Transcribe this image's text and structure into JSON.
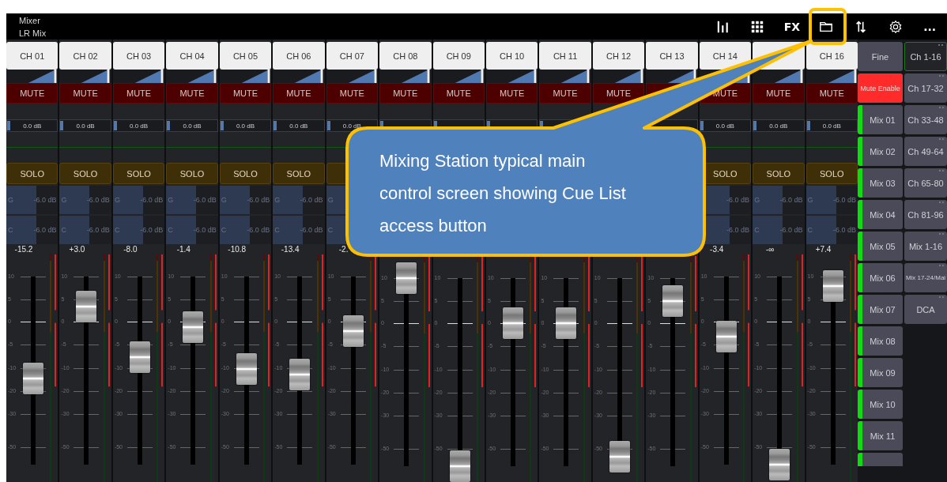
{
  "window": {
    "title": "Mixer",
    "subtitle": "LR Mix"
  },
  "toolbar": [
    {
      "kind": "bars"
    },
    {
      "kind": "grid"
    },
    {
      "kind": "text",
      "label": "FX"
    },
    {
      "kind": "folder",
      "highlighted": true
    },
    {
      "kind": "swap"
    },
    {
      "kind": "gear"
    },
    {
      "kind": "text",
      "label": "..."
    }
  ],
  "channels": [
    {
      "name": "CH 01",
      "mute": "MUTE",
      "gain": "0.0 dB",
      "solo": "SOLO",
      "sends": [
        {
          "label": "G",
          "value": "-6.0 dB"
        },
        {
          "label": "C",
          "value": "-6.0 dB"
        }
      ],
      "value": "-15.2",
      "level": 0.46,
      "scale": [
        "10",
        "5",
        "0",
        "-5",
        "-10",
        "-20",
        "-30",
        "-50"
      ]
    },
    {
      "name": "CH 02",
      "mute": "MUTE",
      "gain": "0.0 dB",
      "solo": "SOLO",
      "sends": [
        {
          "label": "G",
          "value": "-6.0 dB"
        },
        {
          "label": "C",
          "value": "-6.0 dB"
        }
      ],
      "value": "+3.0",
      "level": 0.84,
      "scale": [
        "10",
        "5",
        "0",
        "-5",
        "-10",
        "-20",
        "-30",
        "-50"
      ]
    },
    {
      "name": "CH 03",
      "mute": "MUTE",
      "gain": "0.0 dB",
      "solo": "SOLO",
      "sends": [
        {
          "label": "G",
          "value": "-6.0 dB"
        },
        {
          "label": "C",
          "value": "-6.0 dB"
        }
      ],
      "value": "-8.0",
      "level": 0.57,
      "scale": [
        "10",
        "5",
        "0",
        "-5",
        "-10",
        "-20",
        "-30",
        "-50"
      ]
    },
    {
      "name": "CH 04",
      "mute": "MUTE",
      "gain": "0.0 dB",
      "solo": "SOLO",
      "sends": [
        {
          "label": "G",
          "value": "-6.0 dB"
        },
        {
          "label": "C",
          "value": "-6.0 dB"
        }
      ],
      "value": "-1.4",
      "level": 0.73,
      "scale": [
        "10",
        "5",
        "0",
        "-5",
        "-10",
        "-20",
        "-30",
        "-50"
      ]
    },
    {
      "name": "CH 05",
      "mute": "MUTE",
      "gain": "0.0 dB",
      "solo": "SOLO",
      "sends": [
        {
          "label": "G",
          "value": "-6.0 dB"
        },
        {
          "label": "C",
          "value": "-6.0 dB"
        }
      ],
      "value": "-10.8",
      "level": 0.51,
      "scale": [
        "10",
        "5",
        "0",
        "-5",
        "-10",
        "-20",
        "-30",
        "-50"
      ]
    },
    {
      "name": "CH 06",
      "mute": "MUTE",
      "gain": "0.0 dB",
      "solo": "SOLO",
      "sends": [
        {
          "label": "G",
          "value": "-6.0 dB"
        },
        {
          "label": "C",
          "value": "-6.0 dB"
        }
      ],
      "value": "-13.4",
      "level": 0.48,
      "scale": [
        "10",
        "5",
        "0",
        "-5",
        "-10",
        "-20",
        "-30",
        "-50"
      ]
    },
    {
      "name": "CH 07",
      "mute": "MUTE",
      "gain": "0.0 dB",
      "sends": [
        {
          "label": "G"
        },
        {
          "label": "C"
        }
      ],
      "value": "-2.",
      "level": 0.71,
      "scale": [
        "10",
        "5",
        "0",
        "-5",
        "-10",
        "-20",
        "-30",
        "-50"
      ]
    },
    {
      "name": "CH 08",
      "mute": "MUTE",
      "gain_field": true,
      "level": 1.0,
      "scale": [
        "10",
        "5",
        "0",
        "-5",
        "-10",
        "-20",
        "-30",
        "-50"
      ]
    },
    {
      "name": "CH 09",
      "mute": "MUTE",
      "gain_field": true,
      "level": 0.0,
      "scale": [
        "10",
        "5",
        "0",
        "-5",
        "-10",
        "-20",
        "-30",
        "-50"
      ]
    },
    {
      "name": "CH 10",
      "mute": "MUTE",
      "gain_field": true,
      "level": 0.76,
      "scale": [
        "10",
        "5",
        "0",
        "-5",
        "-10",
        "-20",
        "-30",
        "-50"
      ]
    },
    {
      "name": "CH 11",
      "mute": "MUTE",
      "gain_field": true,
      "level": 0.76,
      "scale": [
        "10",
        "5",
        "0",
        "-5",
        "-10",
        "-20",
        "-30",
        "-50"
      ]
    },
    {
      "name": "CH 12",
      "mute": "MUTE",
      "level": 0.05,
      "scale": [
        "10",
        "5",
        "0",
        "-5",
        "-10",
        "-20",
        "-30",
        "-50"
      ]
    },
    {
      "name": "CH 13",
      "gain_field": true,
      "level": 0.88,
      "scale": [
        "10",
        "5",
        "0",
        "-5",
        "-10",
        "-20",
        "-30",
        "-50"
      ]
    },
    {
      "name": "CH 14",
      "mute": "MUTE",
      "gain": "0.0 dB",
      "solo": "SOLO",
      "sends": [
        {
          "value": "-6.0 dB"
        },
        {
          "value": "-6.0 dB"
        }
      ],
      "value": "-3.4",
      "level": 0.68,
      "scale": [
        "10",
        "5",
        "0",
        "-5",
        "-10",
        "-20",
        "-30",
        "-50"
      ]
    },
    {
      "mute": "MUTE",
      "gain": "0.0 dB",
      "solo": "SOLO",
      "sends": [
        {
          "label": "G",
          "value": "-6.0 dB"
        },
        {
          "label": "C",
          "value": "-6.0 dB"
        }
      ],
      "value": "-∞",
      "level": 0.0,
      "scale": [
        "10",
        "5",
        "0",
        "-5",
        "-10",
        "-20",
        "-30",
        "-50"
      ]
    },
    {
      "name": "CH 16",
      "mute": "MUTE",
      "gain": "0.0 dB",
      "solo": "SOLO",
      "sends": [
        {
          "label": "G",
          "value": "-6.0 dB"
        },
        {
          "label": "C",
          "value": "-6.0 dB"
        }
      ],
      "value": "+7.4",
      "level": 0.95,
      "scale": [
        "10",
        "5",
        "0",
        "-5",
        "-10",
        "-20",
        "-30",
        "-50"
      ]
    }
  ],
  "panel_buttons": [
    {
      "kind": "plain",
      "label": "Fine"
    },
    {
      "kind": "toggle",
      "label": "Mute Enable",
      "on": true
    },
    {
      "kind": "mix",
      "label": "Mix 01"
    },
    {
      "kind": "mix",
      "label": "Mix 02"
    },
    {
      "kind": "mix",
      "label": "Mix 03"
    },
    {
      "kind": "mix",
      "label": "Mix 04"
    },
    {
      "kind": "mix",
      "label": "Mix 05"
    },
    {
      "kind": "mix",
      "label": "Mix 06"
    },
    {
      "kind": "mix",
      "label": "Mix 07"
    },
    {
      "kind": "mix",
      "label": "Mix 08"
    },
    {
      "kind": "mix",
      "label": "Mix 09"
    },
    {
      "kind": "mix",
      "label": "Mix 10"
    },
    {
      "kind": "mix",
      "label": "Mix 11"
    },
    {
      "kind": "mix"
    }
  ],
  "layer_buttons": [
    {
      "label": "Ch 1-16",
      "selected": true
    },
    {
      "label": "Ch 17-32",
      "selected": false
    },
    {
      "label": "Ch 33-48",
      "selected": false
    },
    {
      "label": "Ch 49-64",
      "selected": false
    },
    {
      "label": "Ch 65-80",
      "selected": false
    },
    {
      "label": "Ch 81-96",
      "selected": false
    },
    {
      "label": "Mix 1-16",
      "selected": false
    },
    {
      "label": "Mix 17-24/Mai",
      "selected": false
    },
    {
      "label": "DCA",
      "selected": false
    }
  ],
  "callout": {
    "text": "Mixing Station typical main control screen showing Cue List access button"
  }
}
